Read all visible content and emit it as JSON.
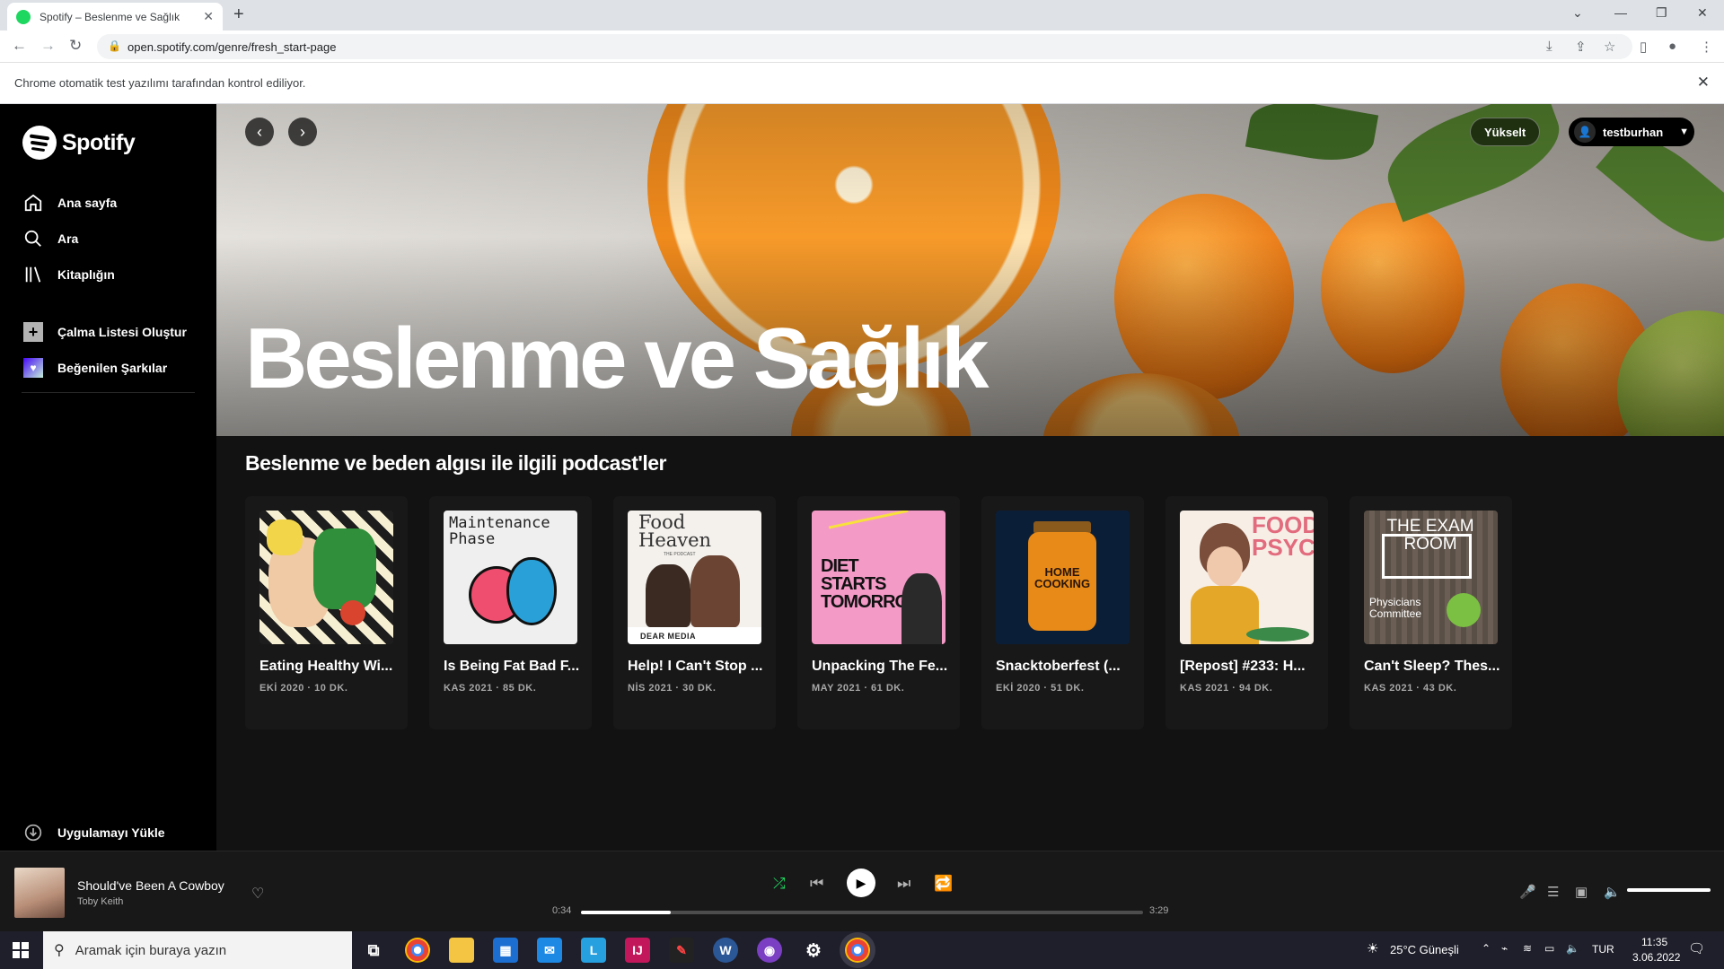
{
  "browser": {
    "tab_title": "Spotify – Beslenme ve Sağlık",
    "url": "open.spotify.com/genre/fresh_start-page",
    "infobar_message": "Chrome otomatik test yazılımı tarafından kontrol ediliyor."
  },
  "sidebar": {
    "logo_text": "Spotify",
    "nav": [
      {
        "label": "Ana sayfa",
        "icon": "home-icon"
      },
      {
        "label": "Ara",
        "icon": "search-icon"
      },
      {
        "label": "Kitaplığın",
        "icon": "library-icon"
      }
    ],
    "create_playlist": "Çalma Listesi Oluştur",
    "liked_songs": "Beğenilen Şarkılar",
    "install_app": "Uygulamayı Yükle"
  },
  "header": {
    "upgrade_label": "Yükselt",
    "username": "testburhan"
  },
  "hero": {
    "title": "Beslenme ve Sağlık"
  },
  "section": {
    "title": "Beslenme ve beden algısı ile ilgili podcast'ler",
    "episodes": [
      {
        "title": "Eating Healthy Wi...",
        "meta": "EKİ 2020 · 10 DK."
      },
      {
        "title": "Is Being Fat Bad F...",
        "meta": "KAS 2021 · 85 DK."
      },
      {
        "title": "Help! I Can't Stop ...",
        "meta": "NİS 2021 · 30 DK."
      },
      {
        "title": "Unpacking The Fe...",
        "meta": "MAY 2021 · 61 DK."
      },
      {
        "title": "Snacktoberfest (...",
        "meta": "EKİ 2020 · 51 DK."
      },
      {
        "title": "[Repost] #233: H...",
        "meta": "KAS 2021 · 94 DK."
      },
      {
        "title": "Can't Sleep? Thes...",
        "meta": "KAS 2021 · 43 DK."
      }
    ],
    "cover_texts": {
      "maintenance": "Maintenance Phase",
      "food_heaven": "Food Heaven",
      "food_heaven_sub": "THE PODCAST",
      "dear_media": "DEAR MEDIA",
      "diet_starts": "DIET STARTS TOMORROW",
      "home_cooking": "HOME COOKING",
      "food_psych": "FOOD PSYCH",
      "exam_room": "THE EXAM ROOM",
      "physicians": "Physicians Committee"
    }
  },
  "player": {
    "track": "Should've Been A Cowboy",
    "artist": "Toby Keith",
    "elapsed": "0:34",
    "duration": "3:29",
    "progress": 0.16,
    "volume": 1.0
  },
  "taskbar": {
    "search_placeholder": "Aramak için buraya yazın",
    "weather": "25°C  Güneşli",
    "lang": "TUR",
    "time": "11:35",
    "date": "3.06.2022"
  },
  "colors": {
    "accent": "#1ed760",
    "background": "#121212",
    "sidebar": "#000000",
    "card": "#181818"
  }
}
